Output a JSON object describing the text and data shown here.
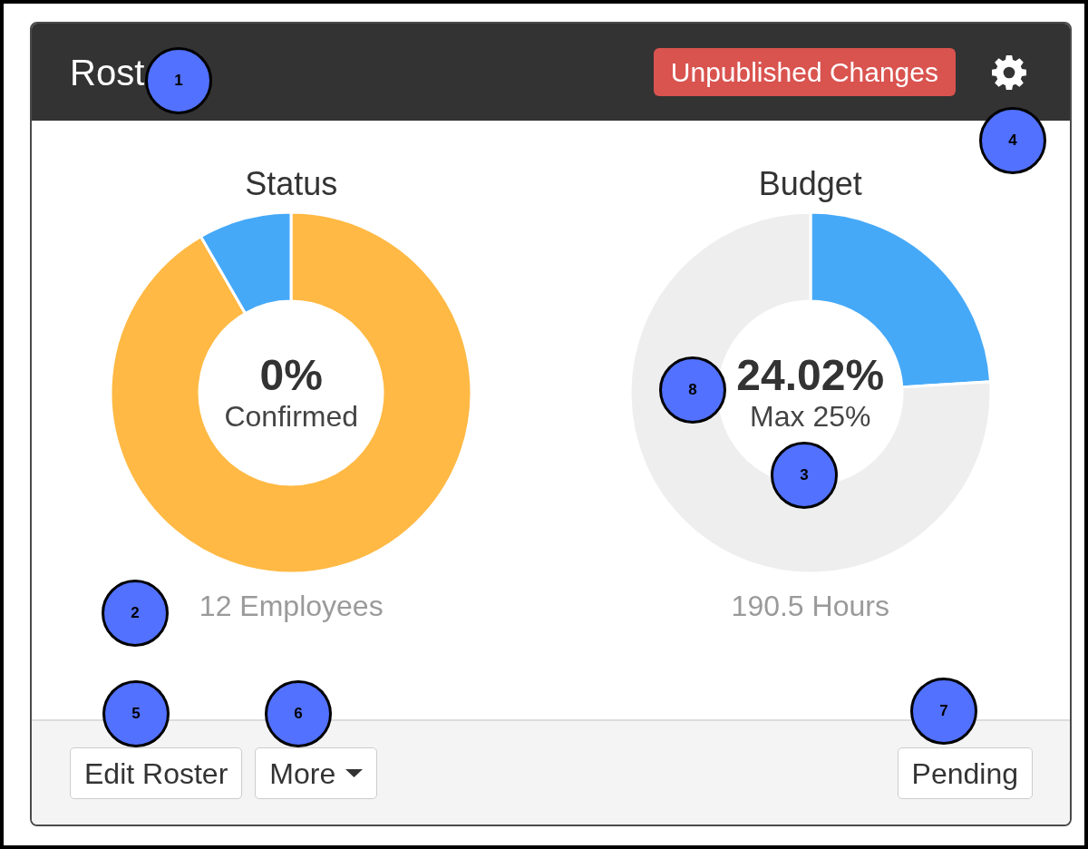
{
  "header": {
    "title": "Rost",
    "badge": "Unpublished Changes"
  },
  "charts": [
    {
      "kind": "split",
      "title": "Status",
      "value": "0%",
      "caption": "Confirmed",
      "total": "12 Employees"
    },
    {
      "kind": "gauge",
      "title": "Budget",
      "value": "24.02%",
      "caption": "Max 25%",
      "total": "190.5 Hours"
    }
  ],
  "footer": {
    "left_buttons": [
      {
        "label": "Edit Roster",
        "dropdown": false
      },
      {
        "label": "More",
        "dropdown": true
      }
    ],
    "right_buttons": [
      {
        "label": "Pending",
        "dropdown": false
      }
    ]
  },
  "markers": [
    {
      "label": "1"
    },
    {
      "label": "2"
    },
    {
      "label": "3"
    },
    {
      "label": "4"
    },
    {
      "label": "5"
    },
    {
      "label": "6"
    },
    {
      "label": "7"
    },
    {
      "label": "8"
    }
  ]
}
